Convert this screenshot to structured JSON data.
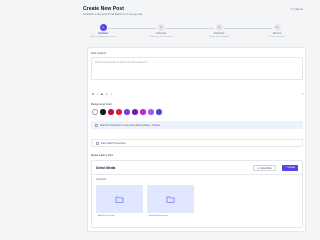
{
  "header": {
    "title": "Create New Post",
    "subtitle": "Schedule a new post for all platforms in one go and",
    "cancel_label": "Cancel"
  },
  "stepper": {
    "steps": [
      {
        "num": "1",
        "label": "Content",
        "desc": "Add & customize your content",
        "active": true
      },
      {
        "num": "2",
        "label": "Channels",
        "desc": "Select your social accounts",
        "active": false
      },
      {
        "num": "3",
        "label": "Schedule",
        "desc": "Choose when to publish",
        "active": false
      },
      {
        "num": "4",
        "label": "Review",
        "desc": "Review and submit",
        "active": false
      }
    ]
  },
  "editor": {
    "content_label": "Post Content",
    "placeholder": "What would you like to share with your audience?",
    "format_tools": [
      "B",
      "I",
      "S",
      "≡",
      "⚲"
    ],
    "counter": "0",
    "bg_label": "Background Color",
    "colors": [
      "#ffffff",
      "#111827",
      "#be123c",
      "#e11d48",
      "#7c3aed",
      "#6b21a8",
      "#c026d3",
      "#a855f7",
      "#4f46e5"
    ],
    "selected_color_index": 0
  },
  "options": {
    "first_comment": "Post first comment on every post when posting",
    "first_comment_link": "Preview",
    "save_draft": "Save draft first sections"
  },
  "media": {
    "section_label": "Media Gallery Files",
    "title": "Select Media",
    "new_folder_label": "New folder",
    "upload_label": "Upload",
    "crumb": "All Media",
    "folders": [
      "Add files for later",
      "Brand file from new"
    ]
  }
}
